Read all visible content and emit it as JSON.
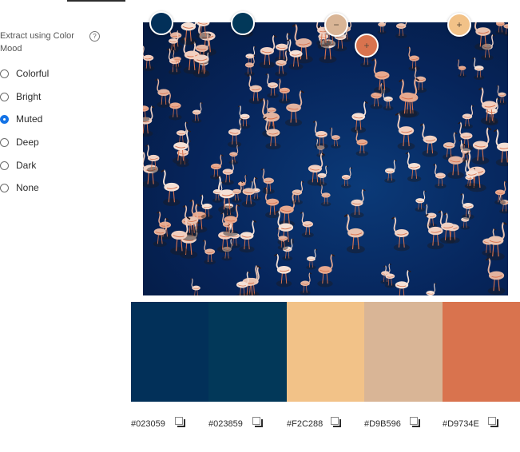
{
  "sidebar": {
    "title": "Extract using Color Mood",
    "help_icon": "?",
    "options": [
      {
        "label": "Colorful",
        "checked": false
      },
      {
        "label": "Bright",
        "checked": false
      },
      {
        "label": "Muted",
        "checked": true
      },
      {
        "label": "Deep",
        "checked": false
      },
      {
        "label": "Dark",
        "checked": false
      },
      {
        "label": "None",
        "checked": false
      }
    ]
  },
  "pickers": [
    {
      "color": "#023059",
      "symbol": ""
    },
    {
      "color": "#023859",
      "symbol": ""
    },
    {
      "color": "#D9B596",
      "symbol": "−"
    },
    {
      "color": "#D9734E",
      "symbol": "+"
    },
    {
      "color": "#F2C288",
      "symbol": "+"
    }
  ],
  "swatches": [
    {
      "hex": "#023059"
    },
    {
      "hex": "#023859"
    },
    {
      "hex": "#F2C288"
    },
    {
      "hex": "#D9B596"
    },
    {
      "hex": "#D9734E"
    }
  ]
}
